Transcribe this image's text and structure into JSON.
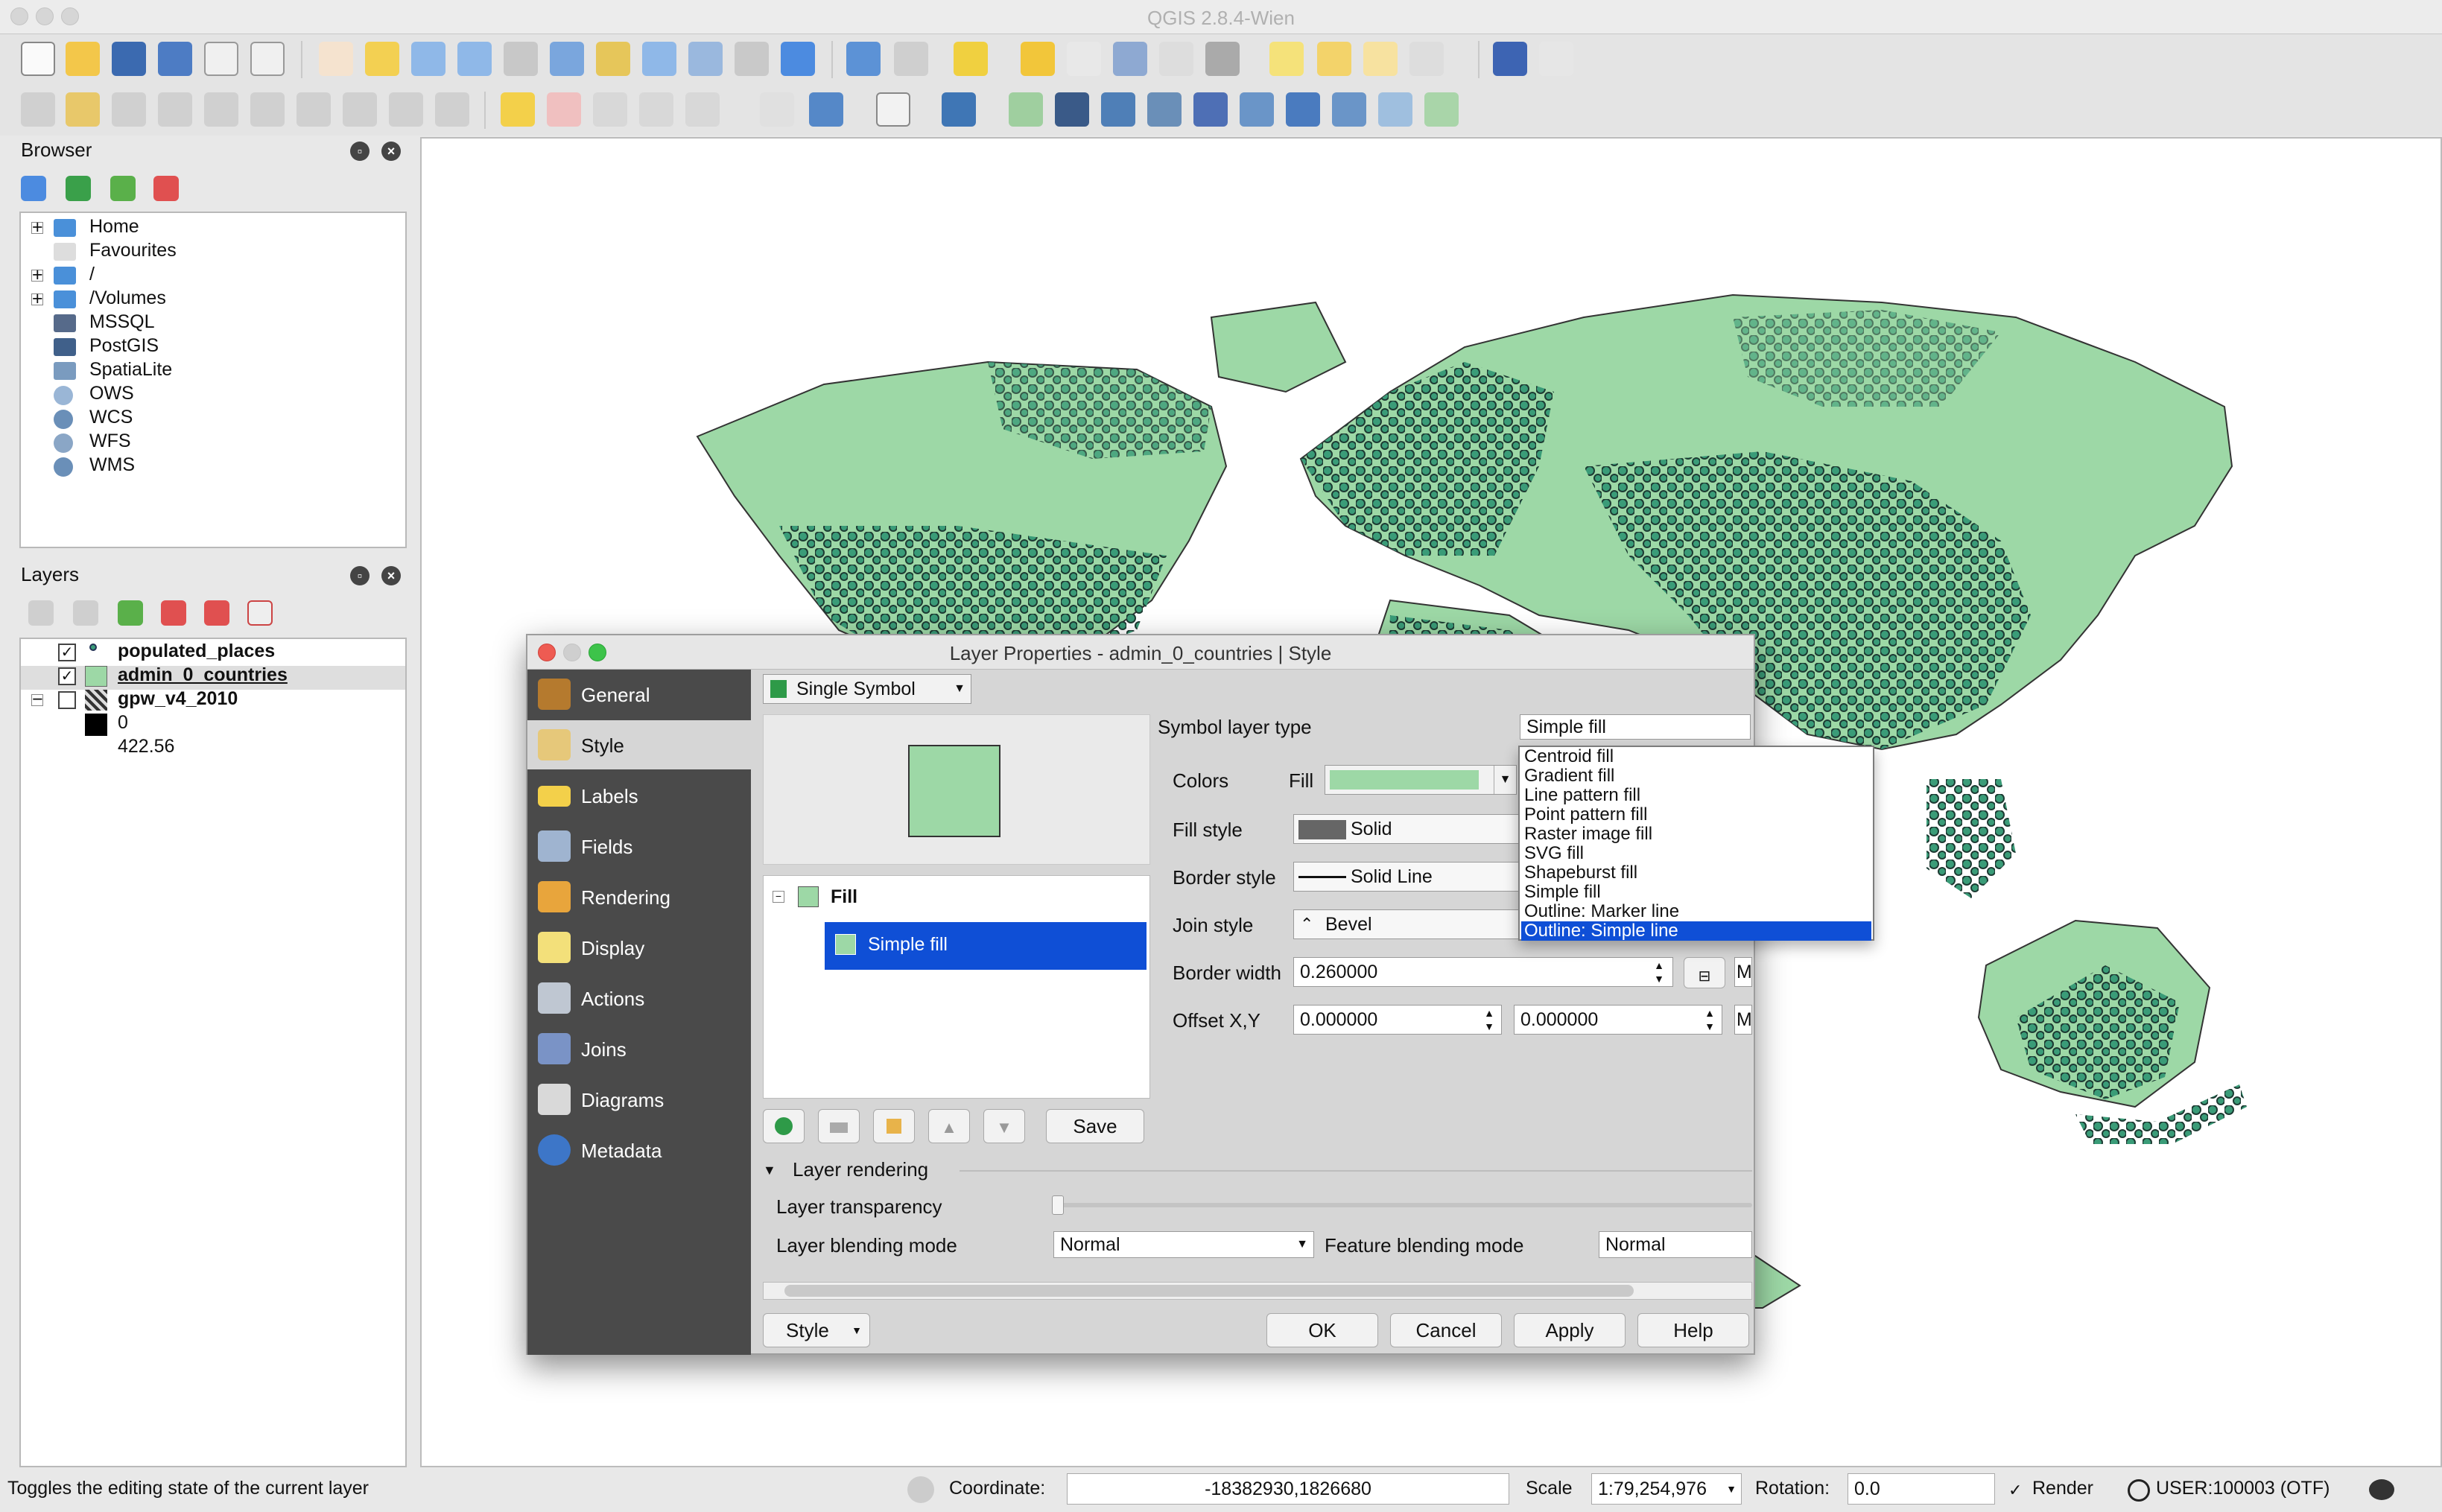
{
  "window": {
    "title": "QGIS 2.8.4-Wien"
  },
  "browser": {
    "title": "Browser",
    "items": [
      {
        "label": "Home",
        "icon": "folder-icon",
        "expandable": true
      },
      {
        "label": "Favourites",
        "icon": "star-icon",
        "expandable": false
      },
      {
        "label": "/",
        "icon": "folder-icon",
        "expandable": true
      },
      {
        "label": "/Volumes",
        "icon": "folder-icon",
        "expandable": true
      },
      {
        "label": "MSSQL",
        "icon": "mssql-icon",
        "expandable": false
      },
      {
        "label": "PostGIS",
        "icon": "postgis-icon",
        "expandable": false
      },
      {
        "label": "SpatiaLite",
        "icon": "spatialite-icon",
        "expandable": false
      },
      {
        "label": "OWS",
        "icon": "globe-icon",
        "expandable": false
      },
      {
        "label": "WCS",
        "icon": "globe-icon",
        "expandable": false
      },
      {
        "label": "WFS",
        "icon": "globe-icon",
        "expandable": false
      },
      {
        "label": "WMS",
        "icon": "globe-icon",
        "expandable": false
      }
    ]
  },
  "layers": {
    "title": "Layers",
    "items": [
      {
        "label": "populated_places",
        "checked": true
      },
      {
        "label": "admin_0_countries",
        "checked": true
      },
      {
        "label": "gpw_v4_2010",
        "checked": false
      }
    ],
    "legend": [
      "0",
      "422.56"
    ]
  },
  "dialog": {
    "title": "Layer Properties - admin_0_countries | Style",
    "sidebar": [
      "General",
      "Style",
      "Labels",
      "Fields",
      "Rendering",
      "Display",
      "Actions",
      "Joins",
      "Diagrams",
      "Metadata"
    ],
    "renderer": "Single Symbol",
    "tree": {
      "parent": "Fill",
      "child": "Simple fill"
    },
    "save_label": "Save",
    "symbol_layer_type_label": "Symbol layer type",
    "symbol_layer_type_value": "Simple fill",
    "colors_label": "Colors",
    "fill_label": "Fill",
    "fill_style_label": "Fill style",
    "fill_style_value": "Solid",
    "border_style_label": "Border style",
    "border_style_value": "Solid Line",
    "join_style_label": "Join style",
    "join_style_value": "Bevel",
    "border_width_label": "Border width",
    "border_width_value": "0.260000",
    "offset_label": "Offset X,Y",
    "offset_x": "0.000000",
    "offset_y": "0.000000",
    "unit_label": "M",
    "layer_rendering_label": "Layer rendering",
    "transparency_label": "Layer transparency",
    "blending_label": "Layer blending mode",
    "blending_value": "Normal",
    "feature_blending_label": "Feature blending mode",
    "feature_blending_value": "Normal",
    "style_button": "Style",
    "ok": "OK",
    "cancel": "Cancel",
    "apply": "Apply",
    "help": "Help",
    "dropdown_options": [
      "Centroid fill",
      "Gradient fill",
      "Line pattern fill",
      "Point pattern fill",
      "Raster image fill",
      "SVG fill",
      "Shapeburst fill",
      "Simple fill",
      "Outline: Marker line",
      "Outline: Simple line"
    ],
    "dropdown_selected": "Outline: Simple line"
  },
  "status": {
    "message": "Toggles the editing state of the current layer",
    "coordinate_label": "Coordinate:",
    "coordinate_value": "-18382930,1826680",
    "scale_label": "Scale",
    "scale_value": "1:79,254,976",
    "rotation_label": "Rotation:",
    "rotation_value": "0.0",
    "render_label": "Render",
    "crs": "USER:100003 (OTF)"
  },
  "colors": {
    "fill": "#9dd8a6",
    "selection": "#0f4fd6",
    "land": "#9dd8a6",
    "point": "#3a9c78"
  }
}
